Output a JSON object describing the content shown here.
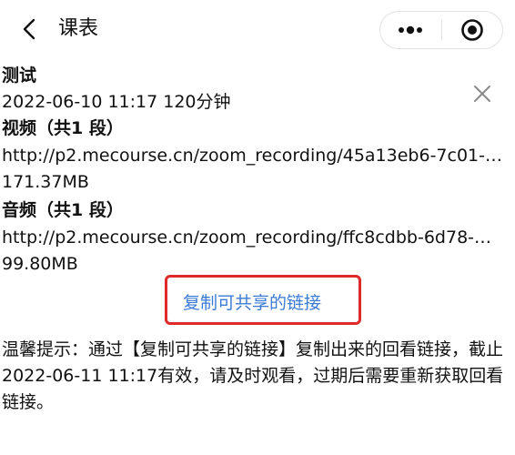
{
  "nav": {
    "title": "课表"
  },
  "recording": {
    "title": "测试",
    "meta": "2022-06-10 11:17 120分钟",
    "video": {
      "heading": "视频（共1 段）",
      "url": "http://p2.mecourse.cn/zoom_recording/45a13eb6-7c01-…",
      "size": "171.37MB"
    },
    "audio": {
      "heading": "音频（共1 段）",
      "url": "http://p2.mecourse.cn/zoom_recording/ffc8cdbb-6d78-…",
      "size": "99.80MB"
    }
  },
  "copy_button_label": "复制可共享的链接",
  "tip": "温馨提示：通过【复制可共享的链接】复制出来的回看链接，截止2022-06-11 11:17有效，请及时观看，过期后需要重新获取回看链接。",
  "colors": {
    "accent": "#3a7bd5",
    "highlight": "#e02a2a"
  }
}
